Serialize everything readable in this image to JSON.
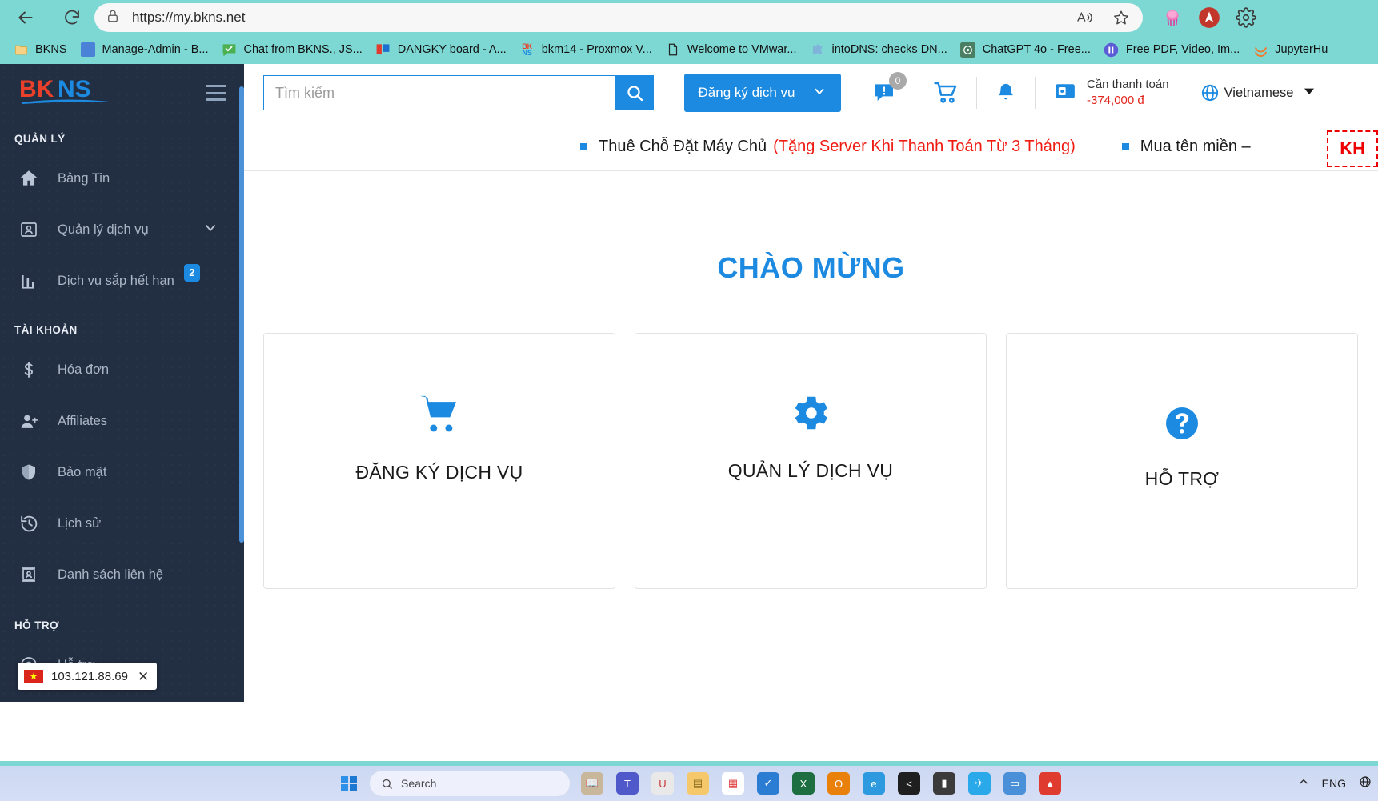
{
  "browser": {
    "url": "https://my.bkns.net",
    "nav": {
      "back": "Back",
      "reload": "Reload"
    },
    "omnibox_icons": [
      "lock-icon",
      "read-aloud-icon",
      "favorite-star-icon"
    ],
    "extensions": [
      "jellyfish-extension-icon",
      "avast-extension-icon",
      "settings-gear-icon"
    ],
    "bookmarks": [
      {
        "label": "BKNS",
        "icon": "folder-icon",
        "color": "#f5c96b"
      },
      {
        "label": "Manage-Admin - B...",
        "icon": "blue-square-icon",
        "color": "#4a82d8"
      },
      {
        "label": "Chat from BKNS., JS...",
        "icon": "green-chat-icon",
        "color": "#4caf50"
      },
      {
        "label": "DANGKY board - A...",
        "icon": "trello-icon",
        "color": "#1c6fd0"
      },
      {
        "label": "bkm14 - Proxmox V...",
        "icon": "bkns-icon",
        "color": "#e8402a"
      },
      {
        "label": "Welcome to VMwar...",
        "icon": "page-icon",
        "color": "#ffffff"
      },
      {
        "label": "intoDNS: checks DN...",
        "icon": "puzzle-icon",
        "color": "#7fb3d9"
      },
      {
        "label": "ChatGPT 4o - Free...",
        "icon": "openai-icon",
        "color": "#4a7f63"
      },
      {
        "label": "Free PDF, Video, Im...",
        "icon": "purple-circle-icon",
        "color": "#5b5bd6"
      },
      {
        "label": "JupyterHu",
        "icon": "jupyter-icon",
        "color": "#f37726"
      }
    ]
  },
  "sidebar": {
    "logo_text": "BKNS",
    "sections": [
      {
        "title": "QUẢN LÝ",
        "items": [
          {
            "label": "Bảng Tin",
            "icon": "home-icon"
          },
          {
            "label": "Quản lý dịch vụ",
            "icon": "id-card-icon",
            "chevron": true
          },
          {
            "label": "Dịch vụ sắp hết hạn",
            "icon": "bar-chart-icon",
            "badge": "2"
          }
        ]
      },
      {
        "title": "TÀI KHOẢN",
        "items": [
          {
            "label": "Hóa đơn",
            "icon": "dollar-icon"
          },
          {
            "label": "Affiliates",
            "icon": "user-plus-icon"
          },
          {
            "label": "Bảo mật",
            "icon": "shield-icon"
          },
          {
            "label": "Lịch sử",
            "icon": "history-icon"
          },
          {
            "label": "Danh sách liên hệ",
            "icon": "contact-card-icon"
          }
        ]
      },
      {
        "title": "HỖ TRỢ",
        "items": [
          {
            "label": "Hỗ trợ",
            "icon": "support-icon"
          }
        ]
      }
    ],
    "ip_tooltip": {
      "ip": "103.121.88.69",
      "flag": "vietnam-flag-icon",
      "close": "✕"
    }
  },
  "topbar": {
    "search_placeholder": "Tìm kiếm",
    "search_value": "",
    "search_button": "search-icon",
    "register_label": "Đăng ký dịch vụ",
    "message_badge": "0",
    "icons": [
      "message-icon",
      "cart-icon",
      "bell-icon",
      "wallet-icon"
    ],
    "wallet": {
      "label": "Cần thanh toán",
      "amount": "-374,000 đ"
    },
    "language": {
      "label": "Vietnamese",
      "icon": "globe-icon"
    }
  },
  "announcement": {
    "items": [
      {
        "text": "Thuê Chỗ Đặt Máy Chủ",
        "highlight": "(Tặng Server Khi Thanh Toán Từ 3 Tháng)"
      },
      {
        "text": "Mua tên miền –",
        "highlight": ""
      }
    ],
    "badge": "KH"
  },
  "main": {
    "welcome_title": "CHÀO MỪNG",
    "cards": [
      {
        "label": "ĐĂNG KÝ DỊCH VỤ",
        "icon": "cart-icon"
      },
      {
        "label": "QUẢN LÝ DỊCH VỤ",
        "icon": "gear-icon"
      },
      {
        "label": "HỖ TRỢ",
        "icon": "question-circle-icon"
      }
    ]
  },
  "taskbar": {
    "search_placeholder": "Search",
    "lang": "ENG",
    "apps": [
      "windows-start-icon",
      "book-icon",
      "teams-icon",
      "dictionary-icon",
      "folder-icon",
      "calendar-icon",
      "todo-icon",
      "excel-icon",
      "outlook-icon",
      "edge-icon",
      "vscode-icon",
      "terminal-icon",
      "telegram-icon",
      "monitor-icon",
      "vlc-icon"
    ]
  },
  "colors": {
    "accent": "#1c8ae0",
    "sidebar_bg": "#222e42",
    "chrome_bg": "#7dd8d4",
    "danger": "#e2241b",
    "logo_red": "#e8402a"
  }
}
